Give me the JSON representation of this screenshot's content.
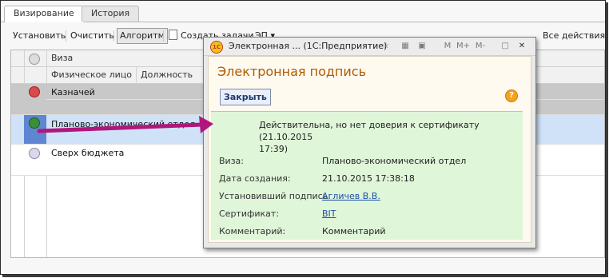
{
  "tabs": [
    {
      "label": "Визирование",
      "active": true
    },
    {
      "label": "История",
      "active": false
    }
  ],
  "toolbar": {
    "install": "Установить",
    "clear": "Очистить",
    "algorithm": "Алгоритм",
    "create_task": "Создать задачи",
    "ep": "ЭП",
    "all_actions": "Все действия"
  },
  "table": {
    "header_top": "Виза",
    "header_person": "Физическое лицо",
    "header_position": "Должность",
    "rows": [
      {
        "text": "Казначей",
        "status": "declined",
        "selected": false
      },
      {
        "text": "Планово-экономический отдел",
        "status": "approved",
        "selected": true
      },
      {
        "text": "Сверх бюджета",
        "status": "pending",
        "selected": false
      }
    ]
  },
  "popup": {
    "window_title": "Электронная ... (1С:Предприятие)",
    "heading": "Электронная подпись",
    "close_button": "Закрыть",
    "help": "?",
    "status_line1": "Действительна, но нет доверия к сертификату (21.10.2015",
    "status_line2": "17:39)",
    "fields": {
      "visa_label": "Виза:",
      "visa_value": "Планово-экономический отдел",
      "created_label": "Дата создания:",
      "created_value": "21.10.2015 17:38:18",
      "signer_label": "Установивший подпись:",
      "signer_value": "Агличев В.В.",
      "cert_label": "Сертификат:",
      "cert_value": "BIT",
      "comment_label": "Комментарий:",
      "comment_value": "Комментарий"
    }
  },
  "colors": {
    "accent_orange": "#b05a00",
    "selection": "#cfe2f8",
    "success_bg": "#dff6d9",
    "arrow": "#b0177c"
  }
}
